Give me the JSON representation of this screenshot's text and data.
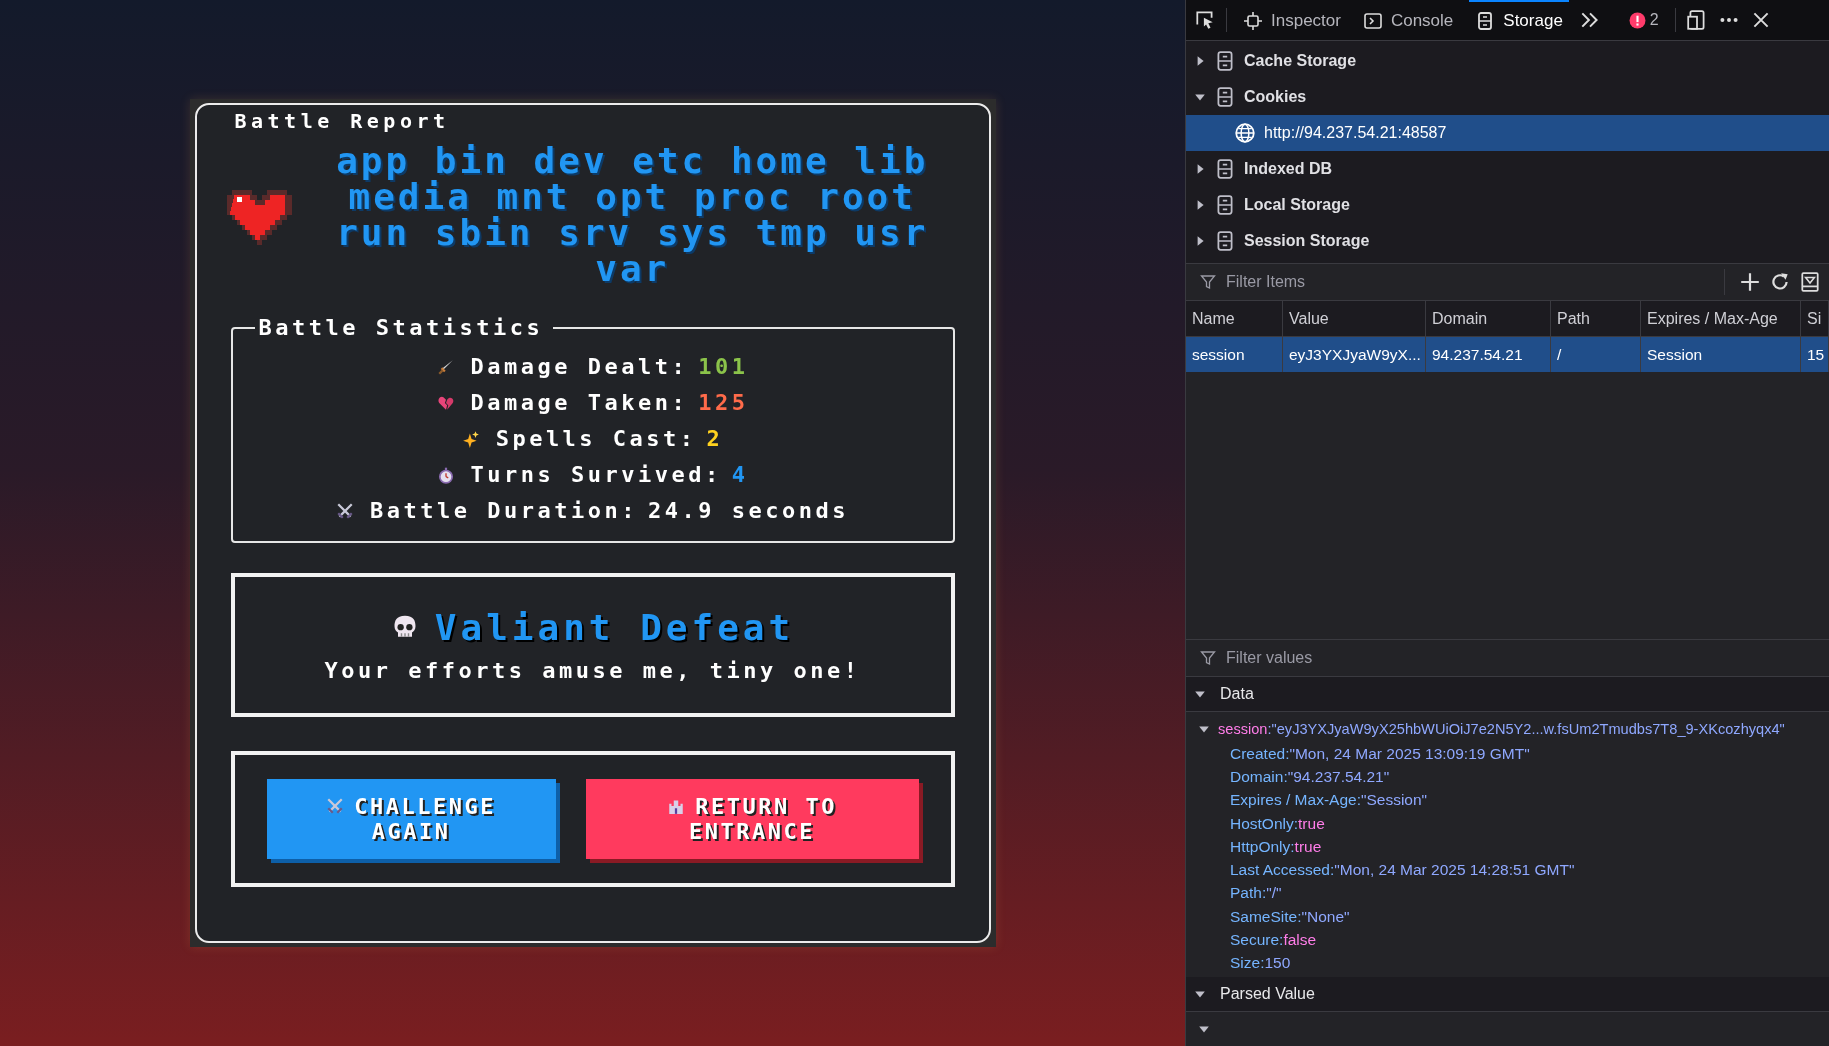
{
  "game": {
    "title": "Battle Report",
    "directories": "app bin dev etc home lib media mnt opt proc root run sbin srv sys tmp usr var",
    "stats_title": "Battle Statistics",
    "stats": [
      {
        "kind": "dagger",
        "label": "Damage Dealt:",
        "value": "101",
        "color": "#8bc34a"
      },
      {
        "kind": "broken-heart",
        "label": "Damage Taken:",
        "value": "125",
        "color": "#ff6b4a"
      },
      {
        "kind": "sparkles",
        "label": "Spells Cast:",
        "value": "2",
        "color": "#ffd21f"
      },
      {
        "kind": "stopwatch",
        "label": "Turns Survived:",
        "value": "4",
        "color": "#2196f3"
      },
      {
        "kind": "crossed-swords",
        "label": "Battle Duration:",
        "value": "24.9 seconds",
        "color": "#ffffff"
      }
    ],
    "result": {
      "title": "Valiant Defeat",
      "message": "Your efforts amuse me, tiny one!"
    },
    "buttons": [
      {
        "kind": "primary",
        "label": "CHALLENGE AGAIN"
      },
      {
        "kind": "danger",
        "label": "RETURN TO ENTRANCE"
      }
    ]
  },
  "devtools": {
    "tabs": [
      {
        "label": "Inspector",
        "selected": false
      },
      {
        "label": "Console",
        "selected": false
      },
      {
        "label": "Storage",
        "selected": true
      }
    ],
    "error_count": "2",
    "tree": [
      {
        "label": "Cache Storage",
        "expanded": false
      },
      {
        "label": "Cookies",
        "expanded": true,
        "children": [
          {
            "label": "http://94.237.54.21:48587",
            "selected": true
          }
        ]
      },
      {
        "label": "Indexed DB",
        "expanded": false
      },
      {
        "label": "Local Storage",
        "expanded": false
      },
      {
        "label": "Session Storage",
        "expanded": false
      }
    ],
    "filter_items": {
      "placeholder": "Filter Items"
    },
    "table": {
      "columns": [
        "Name",
        "Value",
        "Domain",
        "Path",
        "Expires / Max-Age",
        "Si"
      ],
      "rows": [
        {
          "selected": true,
          "cells": [
            "session",
            "eyJ3YXJyaW9yX...",
            "94.237.54.21",
            "/",
            "Session",
            "15"
          ]
        }
      ]
    },
    "filter_values": {
      "placeholder": "Filter values"
    },
    "data": {
      "label": "Data",
      "expanded": true,
      "entry": {
        "key": "session",
        "value": ":\"eyJ3YXJyaW9yX25hbWUiOiJ7e2N5Y2...w.fsUm2Tmudbs7T8_9-XKcozhyqx4\"",
        "expanded": true,
        "properties": [
          {
            "key": "Created:",
            "value": "\"Mon, 24 Mar 2025 13:09:19 GMT\"",
            "kind": "string"
          },
          {
            "key": "Domain:",
            "value": "\"94.237.54.21\"",
            "kind": "string"
          },
          {
            "key": "Expires / Max-Age:",
            "value": "\"Session\"",
            "kind": "string"
          },
          {
            "key": "HostOnly:",
            "value": "true",
            "kind": "bool"
          },
          {
            "key": "HttpOnly:",
            "value": "true",
            "kind": "bool"
          },
          {
            "key": "Last Accessed:",
            "value": "\"Mon, 24 Mar 2025 14:28:51 GMT\"",
            "kind": "string"
          },
          {
            "key": "Path:",
            "value": "\"/\"",
            "kind": "string"
          },
          {
            "key": "SameSite:",
            "value": "\"None\"",
            "kind": "string"
          },
          {
            "key": "Secure:",
            "value": "false",
            "kind": "bool"
          },
          {
            "key": "Size:",
            "value": "150",
            "kind": "number"
          }
        ]
      }
    },
    "parsed_value": {
      "label": "Parsed Value",
      "expanded": true,
      "child_expanded": true
    }
  }
}
